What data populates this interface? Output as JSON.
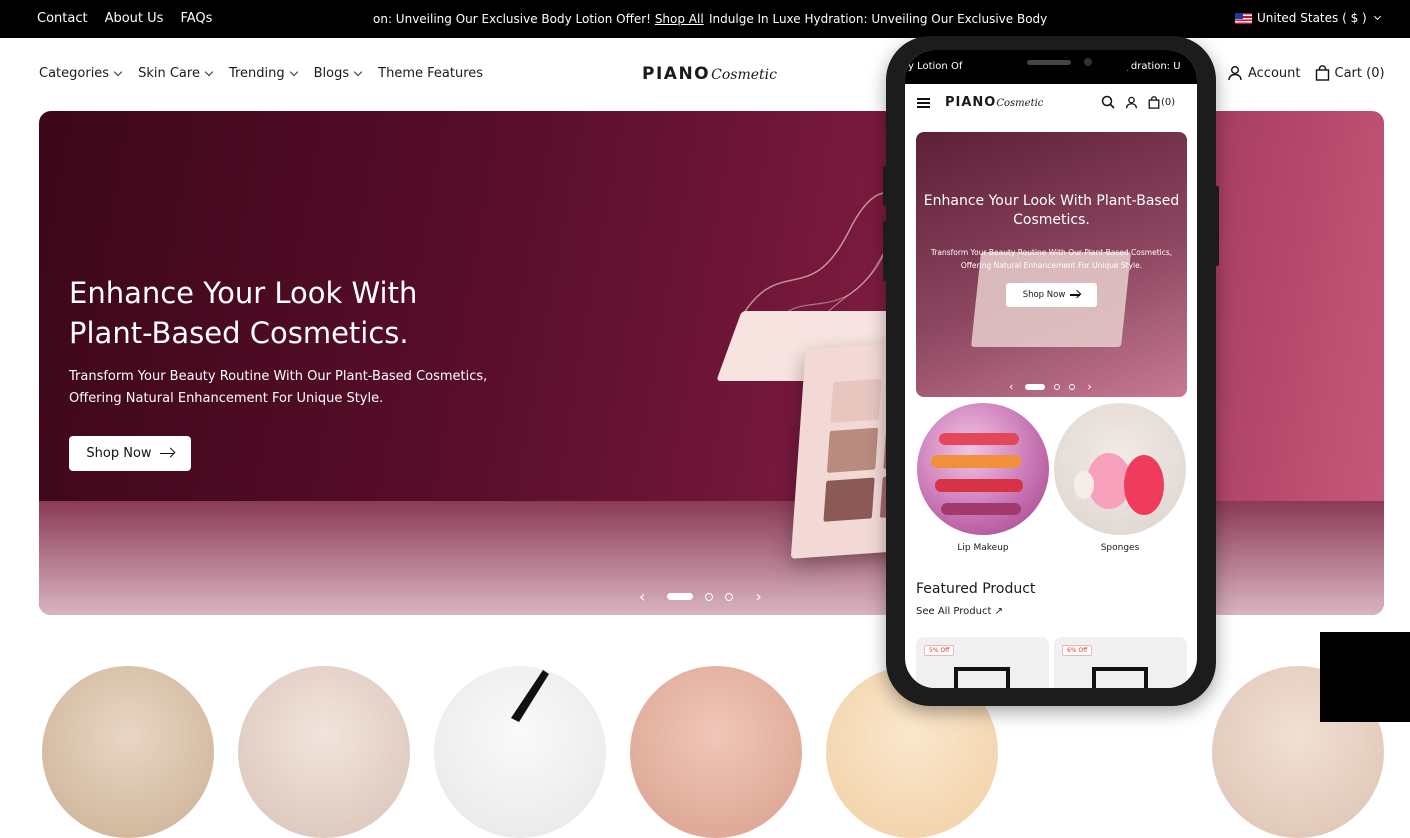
{
  "topbar": {
    "links": [
      "Contact",
      "About Us",
      "FAQs"
    ],
    "announcement_1": "on: Unveiling Our Exclusive Body Lotion Offer!",
    "announcement_1_link": "Shop All",
    "announcement_2": "Indulge In Luxe Hydration: Unveiling Our Exclusive Body Lot",
    "country": "United States ( $ )"
  },
  "nav": {
    "menu": [
      "Categories",
      "Skin Care",
      "Trending",
      "Blogs",
      "Theme Features"
    ],
    "logo_bold": "PIANO",
    "logo_script": "Cosmetic",
    "account": "Account",
    "cart": "Cart (0)"
  },
  "hero": {
    "title": "Enhance Your Look With Plant-Based Cosmetics.",
    "subtitle": "Transform Your Beauty Routine With Our Plant-Based Cosmetics, Offering Natural Enhancement For Unique Style.",
    "button": "Shop Now"
  },
  "mobile": {
    "status_left": "y Lotion Of",
    "status_right": "ydration: U",
    "cart_count": "(0)",
    "hero_title": "Enhance Your Look With Plant-Based Cosmetics.",
    "hero_subtitle": "Transform Your Beauty Routine With Our Plant-Based Cosmetics, Offering Natural Enhancement For Unique Style.",
    "hero_button": "Shop Now",
    "categories": [
      "Lip Makeup",
      "Sponges"
    ],
    "featured_title": "Featured Product",
    "see_all": "See All Product",
    "badges": [
      "5% Off",
      "6% Off"
    ]
  },
  "colors": {
    "hero_dark": "#3c0718",
    "hero_mid": "#7a1a3f",
    "hero_light": "#c85a7c",
    "topbar": "#000000",
    "badge": "#d9342b"
  }
}
